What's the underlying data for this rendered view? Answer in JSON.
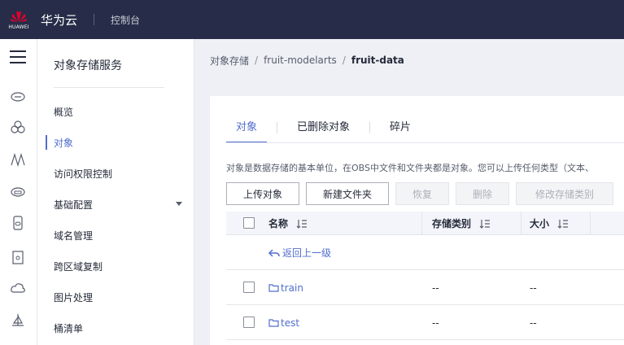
{
  "topbar": {
    "logo_text": "HUAWEI",
    "brand": "华为云",
    "console": "控制台"
  },
  "iconbar": {
    "icons": [
      "cloud-server-icon",
      "cluster-icon",
      "algorithm-icon",
      "storage-icon",
      "database-icon",
      "device-icon",
      "cloud-upload-icon",
      "ship-icon"
    ]
  },
  "sidenav": {
    "title": "对象存储服务",
    "items": [
      {
        "label": "概览"
      },
      {
        "label": "对象"
      },
      {
        "label": "访问权限控制"
      },
      {
        "label": "基础配置"
      },
      {
        "label": "域名管理"
      },
      {
        "label": "跨区域复制"
      },
      {
        "label": "图片处理"
      },
      {
        "label": "桶清单"
      }
    ],
    "active_index": 1
  },
  "breadcrumb": {
    "items": [
      "对象存储",
      "fruit-modelarts"
    ],
    "separator": "/",
    "current": "fruit-data"
  },
  "tabs": [
    {
      "label": "对象"
    },
    {
      "label": "已删除对象"
    },
    {
      "label": "碎片"
    }
  ],
  "description": "对象是数据存储的基本单位，在OBS中文件和文件夹都是对象。您可以上传任何类型（文本、",
  "buttons": {
    "upload": "上传对象",
    "new_folder": "新建文件夹",
    "restore": "恢复",
    "delete": "删除",
    "modify_storage": "修改存储类别"
  },
  "table": {
    "columns": [
      "名称",
      "存储类别",
      "大小"
    ],
    "back_label": "返回上一级",
    "rows": [
      {
        "name": "train",
        "storage": "--",
        "size": "--"
      },
      {
        "name": "test",
        "storage": "--",
        "size": "--"
      }
    ]
  },
  "colors": {
    "topbar": "#272d48",
    "accent": "#526ecc",
    "text": "#252b3a"
  }
}
